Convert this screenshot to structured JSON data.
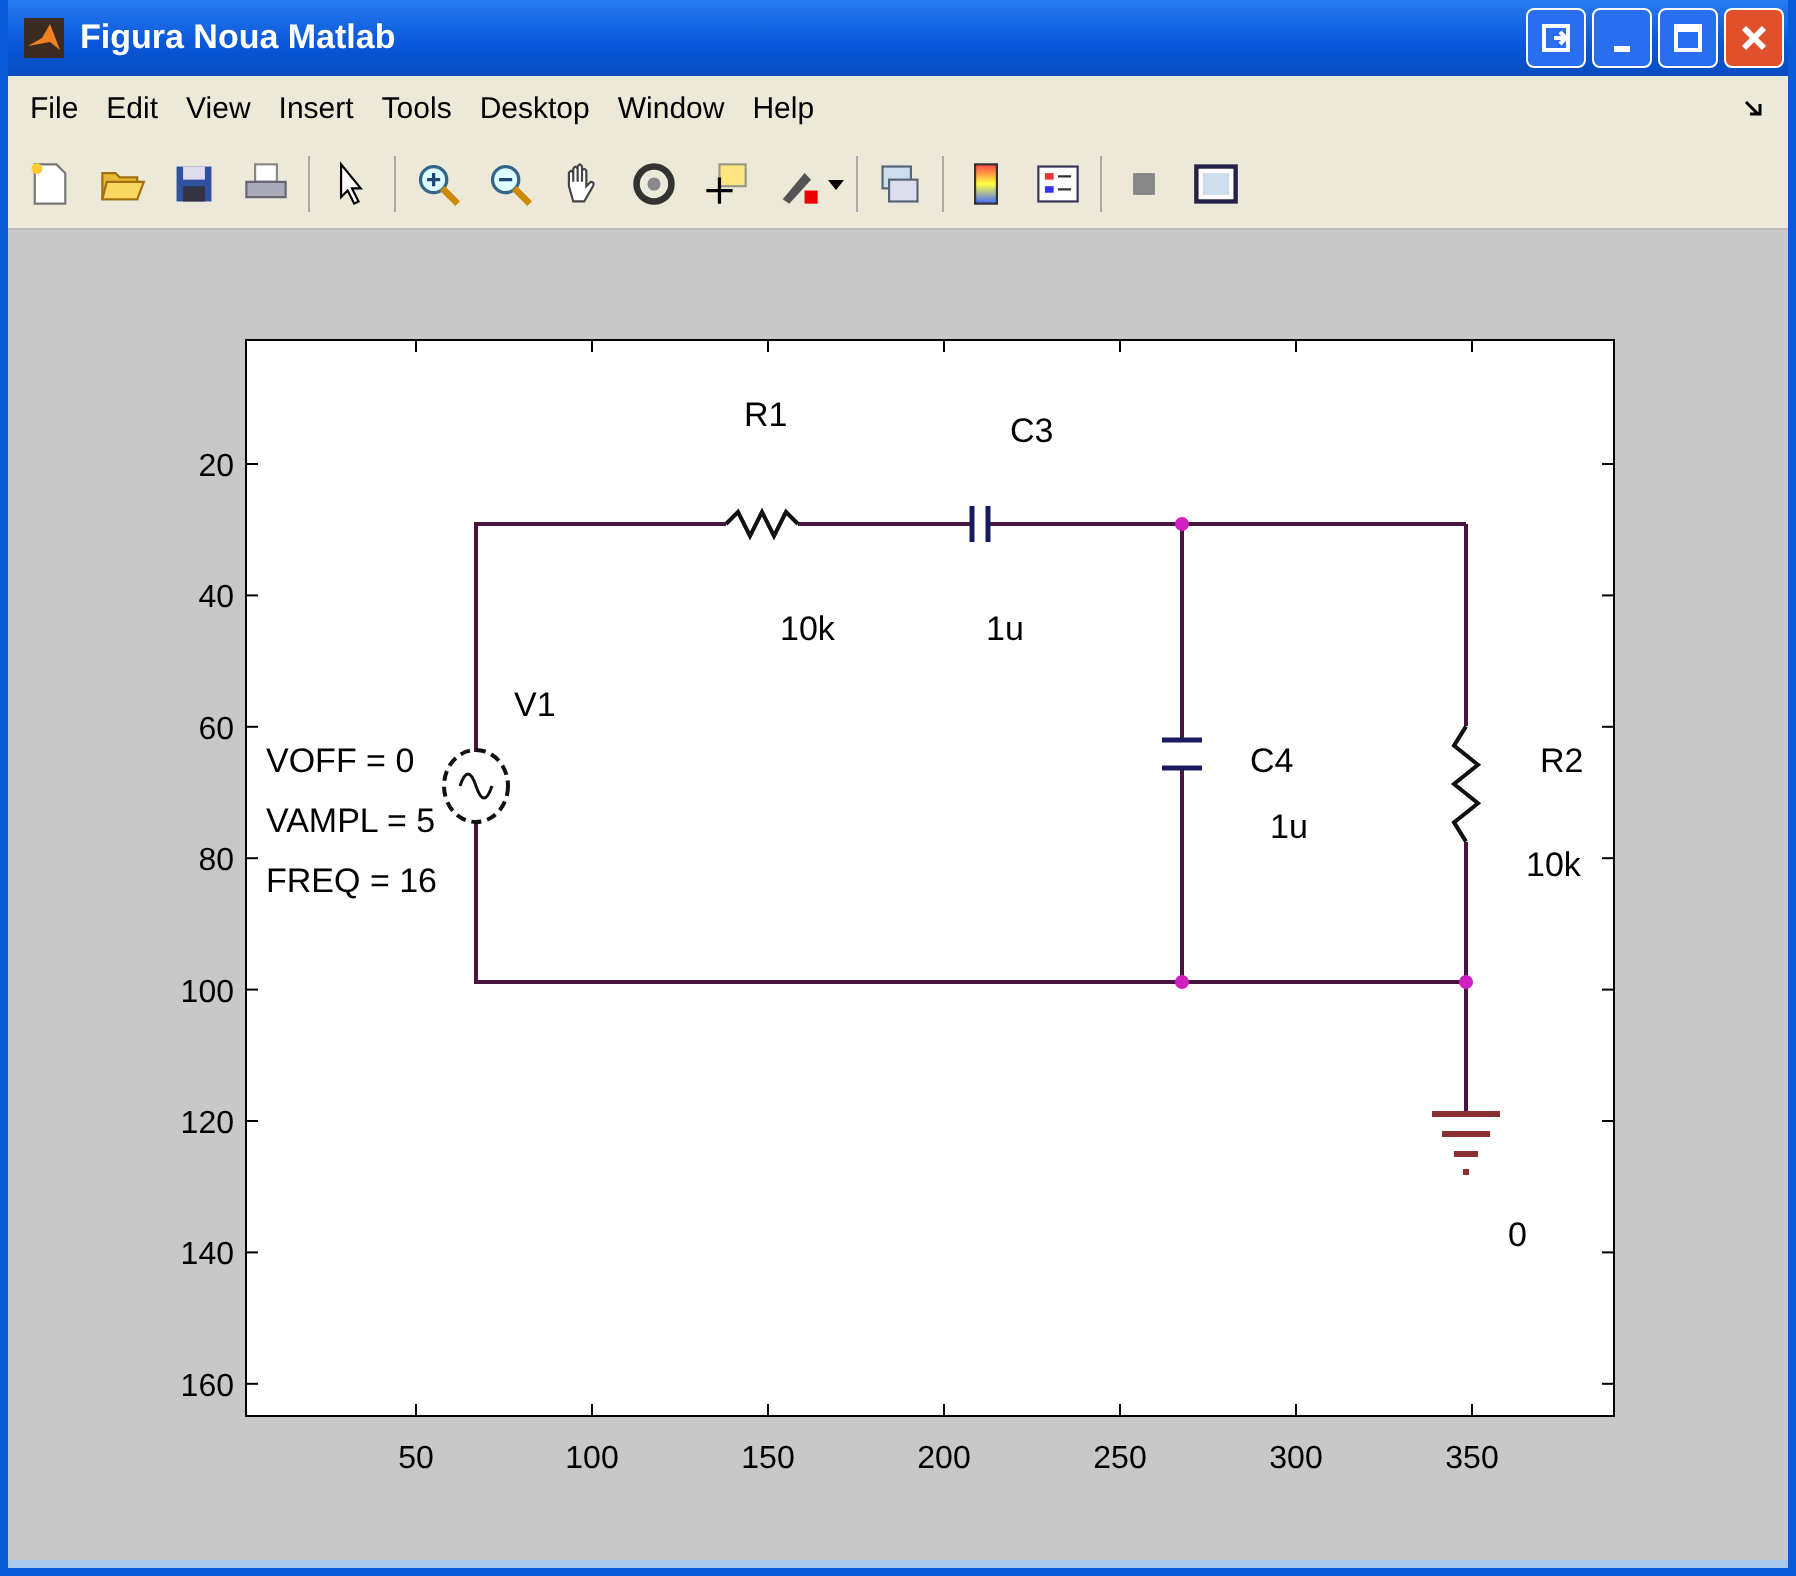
{
  "window": {
    "title": "Figura Noua Matlab"
  },
  "menu": [
    "File",
    "Edit",
    "View",
    "Insert",
    "Tools",
    "Desktop",
    "Window",
    "Help"
  ],
  "axes": {
    "xticks": [
      "50",
      "100",
      "150",
      "200",
      "250",
      "300",
      "350"
    ],
    "yticks": [
      "20",
      "40",
      "60",
      "80",
      "100",
      "120",
      "140",
      "160"
    ]
  },
  "schematic": {
    "components": [
      {
        "kind": "source",
        "name": "V1",
        "params": [
          "VOFF = 0",
          "VAMPL = 5",
          "FREQ = 16"
        ]
      },
      {
        "kind": "resistor",
        "name": "R1",
        "value": "10k"
      },
      {
        "kind": "capacitor",
        "name": "C3",
        "value": "1u"
      },
      {
        "kind": "capacitor",
        "name": "C4",
        "value": "1u"
      },
      {
        "kind": "resistor",
        "name": "R2",
        "value": "10k"
      },
      {
        "kind": "ground",
        "name": "0"
      }
    ]
  }
}
